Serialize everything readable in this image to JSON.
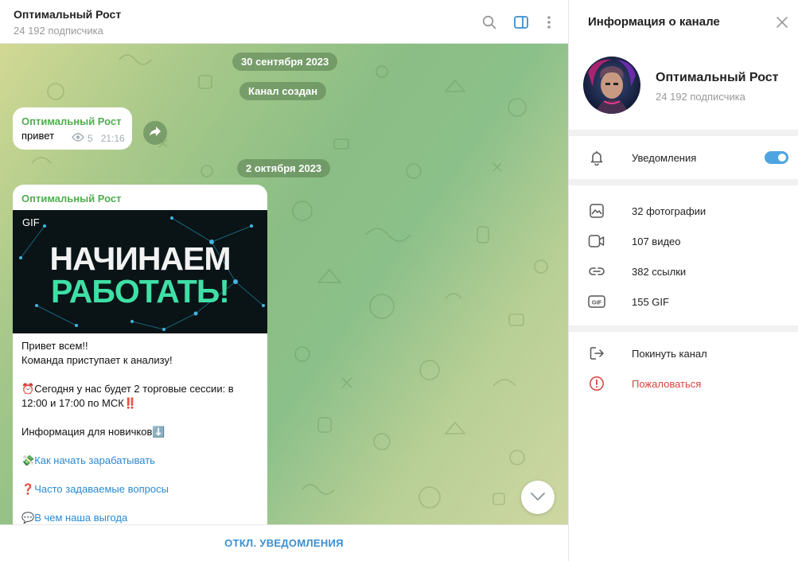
{
  "chat": {
    "title": "Оптимальный Рост",
    "subscribers": "24 192 подписчика"
  },
  "icons": {
    "search": "search-icon",
    "panel": "sidebar-panel-icon",
    "more": "more-vertical-icon",
    "views": "eye-icon",
    "share": "share-arrow-icon",
    "scroll": "chevron-down-icon",
    "close": "close-icon",
    "bell": "bell-icon",
    "photo": "photo-icon",
    "video": "video-icon",
    "link": "link-icon",
    "gif": "gif-icon",
    "leave": "leave-icon",
    "report": "warning-icon"
  },
  "messages": {
    "date1": "30 сентября 2023",
    "service": "Канал создан",
    "m1": {
      "author": "Оптимальный Рост",
      "text": "привет",
      "views": "5",
      "time": "21:16"
    },
    "date2": "2 октября 2023",
    "m2": {
      "author": "Оптимальный Рост",
      "gif_badge": "GIF",
      "gif_line1": "НАЧИНАЕМ",
      "gif_line2": "РАБОТАТЬ!",
      "l1": "Привет всем!!",
      "l2": "Команда приступает к анализу!",
      "l3_emoji": "⏰",
      "l3": "Сегодня у нас будет 2 торговые сессии: в 12:00 и 17:00 по МСК",
      "l3_end": "‼️",
      "l4": "Информация для новичков",
      "l4_emoji": "⬇️",
      "link1_emoji": "💸",
      "link1": "Как начать зарабатывать",
      "link2_emoji": "❓",
      "link2": "Часто задаваемые вопросы",
      "link3_emoji": "💬",
      "link3": "В чем наша выгода"
    }
  },
  "bottom": {
    "mute_label": "ОТКЛ. УВЕДОМЛЕНИЯ"
  },
  "info": {
    "title": "Информация о канале",
    "name": "Оптимальный Рост",
    "subscribers": "24 192 подписчика",
    "notifications_label": "Уведомления",
    "notifications_on": true,
    "photos": "32 фотографии",
    "videos": "107 видео",
    "links": "382 ссылки",
    "gifs": "155 GIF",
    "leave": "Покинуть канал",
    "report": "Пожаловаться"
  },
  "colors": {
    "accent": "#3a8fd0",
    "author": "#4fae4e",
    "danger": "#d9443f",
    "toggle": "#4ea4e0"
  }
}
